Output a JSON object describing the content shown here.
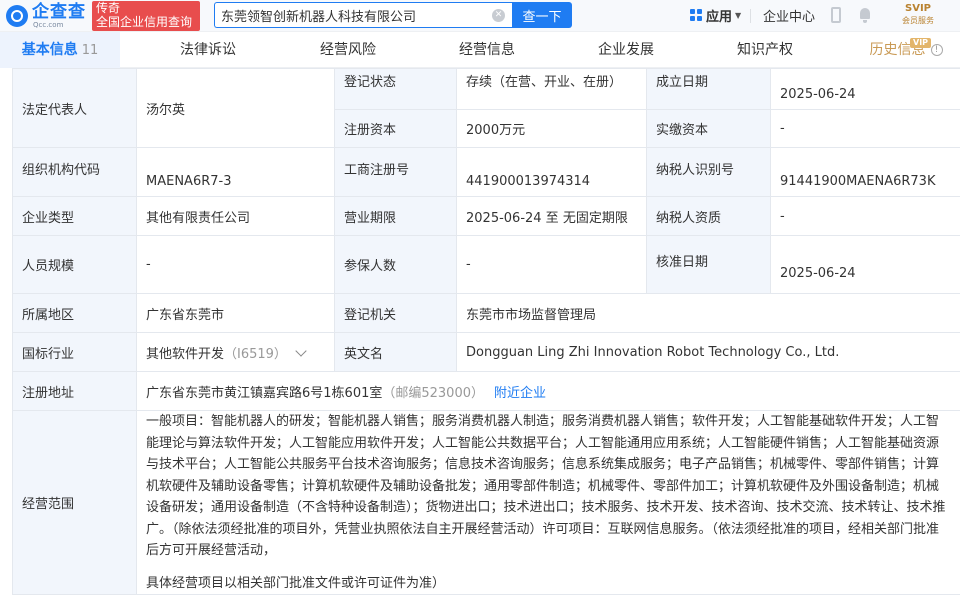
{
  "header": {
    "logo_text": "企查查",
    "logo_sub": "Qcc.com",
    "brand_line1": "传奇",
    "brand_line2": "全国企业信用查询",
    "search_value": "东莞领智创新机器人科技有限公司",
    "search_button": "查一下",
    "app_menu": "应用",
    "enterprise_center": "企业中心",
    "svip_line1": "SVIP",
    "svip_line2": "会员服务"
  },
  "tabs": [
    {
      "label": "基本信息",
      "count": "11"
    },
    {
      "label": "法律诉讼"
    },
    {
      "label": "经营风险"
    },
    {
      "label": "经营信息"
    },
    {
      "label": "企业发展"
    },
    {
      "label": "知识产权"
    },
    {
      "label": "历史信息"
    }
  ],
  "vip_tag": "VIP",
  "info": {
    "legal_rep_label": "法定代表人",
    "legal_rep_value": "汤尔英",
    "reg_status_label": "登记状态",
    "reg_status_value": "存续（在营、开业、在册）",
    "est_date_label": "成立日期",
    "est_date_value": "2025-06-24",
    "reg_capital_label": "注册资本",
    "reg_capital_value": "2000万元",
    "paid_capital_label": "实缴资本",
    "paid_capital_value": "-",
    "org_code_label": "组织机构代码",
    "org_code_value": "MAENA6R7-3",
    "biz_reg_label": "工商注册号",
    "biz_reg_value": "441900013974314",
    "tax_id_label": "纳税人识别号",
    "tax_id_value": "91441900MAENA6R73K",
    "ent_type_label": "企业类型",
    "ent_type_value": "其他有限责任公司",
    "biz_term_label": "营业期限",
    "biz_term_value": "2025-06-24 至 无固定期限",
    "taxpayer_qual_label": "纳税人资质",
    "taxpayer_qual_value": "-",
    "staff_size_label": "人员规模",
    "staff_size_value": "-",
    "insured_label": "参保人数",
    "insured_value": "-",
    "approval_date_label": "核准日期",
    "approval_date_value": "2025-06-24",
    "region_label": "所属地区",
    "region_value": "广东省东莞市",
    "reg_authority_label": "登记机关",
    "reg_authority_value": "东莞市市场监督管理局",
    "industry_label": "国标行业",
    "industry_value": "其他软件开发",
    "industry_code": "（I6519）",
    "english_name_label": "英文名",
    "english_name_value": "Dongguan Ling Zhi Innovation Robot Technology Co., Ltd.",
    "address_label": "注册地址",
    "address_value": "广东省东莞市黄江镇嘉宾路6号1栋601室",
    "postcode": "（邮编523000）",
    "nearby_link": "附近企业",
    "scope_label": "经营范围",
    "scope_value": "一般项目：智能机器人的研发；智能机器人销售；服务消费机器人制造；服务消费机器人销售；软件开发；人工智能基础软件开发；人工智能理论与算法软件开发；人工智能应用软件开发；人工智能公共数据平台；人工智能通用应用系统；人工智能硬件销售；人工智能基础资源与技术平台；人工智能公共服务平台技术咨询服务；信息技术咨询服务；信息系统集成服务；电子产品销售；机械零件、零部件销售；计算机软硬件及辅助设备零售；计算机软硬件及辅助设备批发；通用零部件制造；机械零件、零部件加工；计算机软硬件及外围设备制造；机械设备研发；通用设备制造（不含特种设备制造）；货物进出口；技术进出口；技术服务、技术开发、技术咨询、技术交流、技术转让、技术推广。（除依法须经批准的项目外，凭营业执照依法自主开展经营活动）许可项目：互联网信息服务。（依法须经批准的项目，经相关部门批准后方可开展经营活动，",
    "scope_note": "具体经营项目以相关部门批准文件或许可证件为准）"
  }
}
